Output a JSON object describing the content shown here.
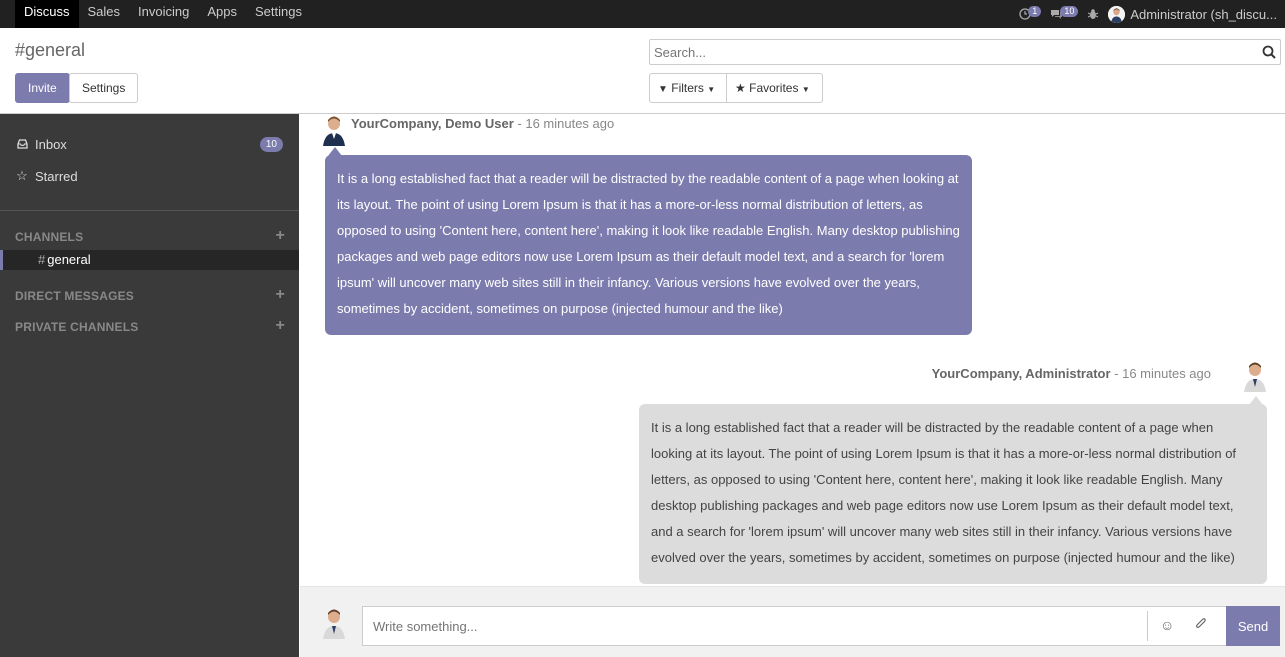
{
  "navbar": {
    "menu": [
      "Discuss",
      "Sales",
      "Invoicing",
      "Apps",
      "Settings"
    ],
    "activity_count": "1",
    "messages_count": "10",
    "user_name": "Administrator (sh_discu..."
  },
  "control_panel": {
    "title": "#general",
    "invite_label": "Invite",
    "settings_label": "Settings",
    "search_placeholder": "Search...",
    "filters_label": "Filters",
    "favorites_label": "Favorites"
  },
  "sidebar": {
    "inbox_label": "Inbox",
    "inbox_count": "10",
    "starred_label": "Starred",
    "channels_header": "CHANNELS",
    "channel_hash": "#",
    "channel_name": "general",
    "direct_messages_header": "DIRECT MESSAGES",
    "private_channels_header": "PRIVATE CHANNELS"
  },
  "messages": [
    {
      "author": "YourCompany, Demo User",
      "date": " - 16 minutes ago",
      "body": "It is a long established fact that a reader will be distracted by the readable content of a page when looking at its layout. The point of using Lorem Ipsum is that it has a more-or-less normal distribution of letters, as opposed to using 'Content here, content here', making it look like readable English. Many desktop publishing packages and web page editors now use Lorem Ipsum as their default model text, and a search for 'lorem ipsum' will uncover many web sites still in their infancy. Various versions have evolved over the years, sometimes by accident, sometimes on purpose (injected humour and the like)"
    },
    {
      "author": "YourCompany, Administrator",
      "date": " - 16 minutes ago",
      "body": "It is a long established fact that a reader will be distracted by the readable content of a page when looking at its layout. The point of using Lorem Ipsum is that it has a more-or-less normal distribution of letters, as opposed to using 'Content here, content here', making it look like readable English. Many desktop publishing packages and web page editors now use Lorem Ipsum as their default model text, and a search for 'lorem ipsum' will uncover many web sites still in their infancy. Various versions have evolved over the years, sometimes by accident, sometimes on purpose (injected humour and the like)"
    }
  ],
  "composer": {
    "placeholder": "Write something...",
    "send_label": "Send"
  },
  "colors": {
    "accent": "#7c7bad",
    "navbar": "#212121",
    "sidebar": "#3a3a3a"
  }
}
